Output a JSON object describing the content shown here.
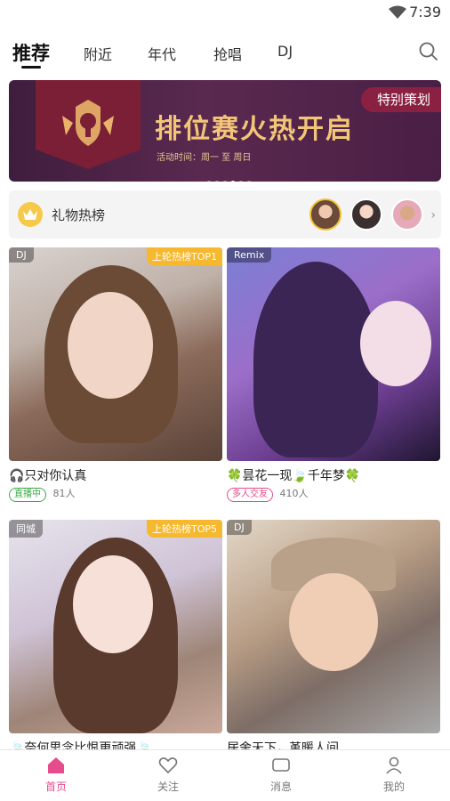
{
  "status_bar": {
    "time": "7:39"
  },
  "tabs": [
    {
      "label": "推荐",
      "active": true
    },
    {
      "label": "附近"
    },
    {
      "label": "年代"
    },
    {
      "label": "抢唱"
    },
    {
      "label": "DJ"
    }
  ],
  "banner": {
    "title": "排位赛火热开启",
    "subtitle": "活动时间：周一 至 周日",
    "badge": "特别策划",
    "dots_count": 6,
    "active_dot": 3
  },
  "gift_rank": {
    "label": "礼物热榜"
  },
  "cards": [
    {
      "tag": "DJ",
      "rank": "上轮热榜TOP1",
      "title": "🎧只对你认真",
      "status": "直播中",
      "count": "81人"
    },
    {
      "tag": "Remix",
      "rank": "",
      "title": "🍀昙花一现🍃千年梦🍀",
      "status": "多人交友",
      "count": "410人"
    },
    {
      "tag": "同城",
      "rank": "上轮热榜TOP5",
      "title": "🍃奈何思念比恨更顽强🍃",
      "status": "",
      "count": ""
    },
    {
      "tag": "DJ",
      "rank": "",
      "title": "居舍天下，堇暖人间",
      "status": "",
      "count": ""
    }
  ],
  "bottom_nav": [
    {
      "label": "首页",
      "active": true
    },
    {
      "label": "关注"
    },
    {
      "label": "消息"
    },
    {
      "label": "我的"
    }
  ],
  "colors": {
    "accent": "#e64c8c",
    "rank_badge": "#f5b82e",
    "banner_title": "#f2c676"
  }
}
